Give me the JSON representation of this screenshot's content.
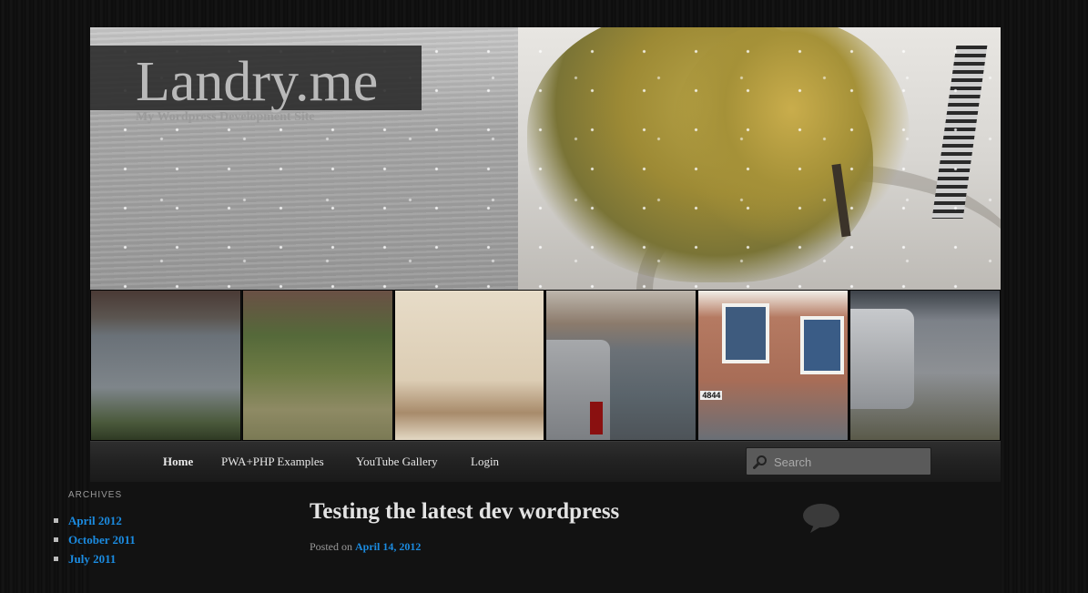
{
  "site": {
    "title": "Landry.me",
    "description": "My Wordpress Development Site"
  },
  "header": {
    "photos": [
      {
        "name": "flooded-street-photo"
      },
      {
        "name": "fallen-sign-photo"
      },
      {
        "name": "ceiling-photo"
      },
      {
        "name": "flooded-parking-photo"
      },
      {
        "name": "brick-house-photo"
      },
      {
        "name": "truck-flood-photo"
      }
    ],
    "house_number": "4844"
  },
  "nav": {
    "items": [
      {
        "label": "Home"
      },
      {
        "label": "PWA+PHP Examples"
      },
      {
        "label": "YouTube Gallery"
      },
      {
        "label": "Login"
      }
    ],
    "search_placeholder": "Search"
  },
  "sidebar": {
    "archives_title": "ARCHIVES",
    "archives": [
      {
        "label": "April 2012"
      },
      {
        "label": "October 2011"
      },
      {
        "label": "July 2011"
      }
    ]
  },
  "post": {
    "title": "Testing the latest dev wordpress",
    "posted_on_label": "Posted on",
    "date": "April 14, 2012"
  },
  "colors": {
    "link": "#1b8be0",
    "nav_bg": "#222222",
    "body_bg": "#121212"
  }
}
